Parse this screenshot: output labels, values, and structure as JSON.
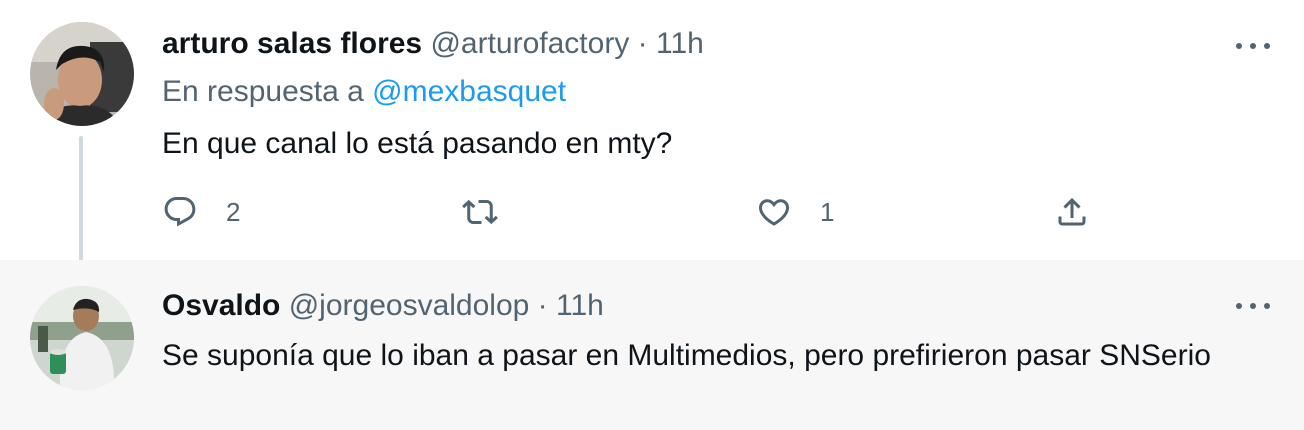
{
  "tweets": [
    {
      "name": "arturo salas flores",
      "handle": "@arturofactory",
      "separator": "·",
      "time": "11h",
      "reply_prefix": "En respuesta a",
      "reply_mention": "@mexbasquet",
      "text": "En que canal lo está pasando en mty?",
      "actions": {
        "replies": "2",
        "retweets": "",
        "likes": "1"
      }
    },
    {
      "name": "Osvaldo",
      "handle": "@jorgeosvaldolop",
      "separator": "·",
      "time": "11h",
      "text": "Se suponía que lo iban a pasar en Multimedios, pero prefirieron pasar SNSerio"
    }
  ],
  "colors": {
    "text_primary": "#0f1419",
    "text_secondary": "#536471",
    "link": "#1d9bf0",
    "thread_line": "#cfd9de",
    "highlight_bg": "#f7f7f7"
  },
  "icons": [
    "reply-icon",
    "retweet-icon",
    "like-icon",
    "share-icon",
    "more-icon"
  ]
}
